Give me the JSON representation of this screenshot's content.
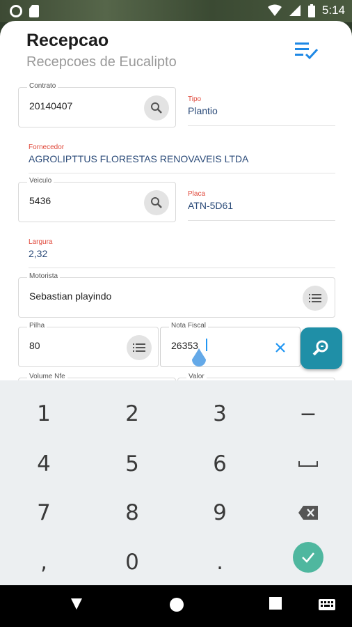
{
  "status_bar": {
    "time": "5:14"
  },
  "header": {
    "title": "Recepcao",
    "subtitle": "Recepcoes de Eucalipto"
  },
  "form": {
    "contrato": {
      "label": "Contrato",
      "value": "20140407"
    },
    "tipo": {
      "label": "Tipo",
      "value": "Plantio"
    },
    "fornecedor": {
      "label": "Fornecedor",
      "value": "AGROLIPTTUS FLORESTAS RENOVAVEIS LTDA"
    },
    "veiculo": {
      "label": "Veiculo",
      "value": "5436"
    },
    "placa": {
      "label": "Placa",
      "value": "ATN-5D61"
    },
    "largura": {
      "label": "Largura",
      "value": "2,32"
    },
    "motorista": {
      "label": "Motorista",
      "value": "Sebastian playindo"
    },
    "pilha": {
      "label": "Pilha",
      "value": "80"
    },
    "nota_fiscal": {
      "label": "Nota Fiscal",
      "value": "26353"
    },
    "volume_nfe": {
      "label": "Volume Nfe",
      "value": ""
    },
    "valor": {
      "label": "Valor",
      "value": ""
    }
  },
  "keypad": {
    "keys": [
      "1",
      "2",
      "3",
      "−",
      "4",
      "5",
      "6",
      "␣",
      "7",
      "8",
      "9",
      "⌫",
      ",",
      "0",
      ".",
      "✓"
    ]
  },
  "colors": {
    "fab": "#1f8fa7",
    "accent_blue": "#2196f3",
    "label_red": "#e04a3c",
    "value_blue": "#2a4a78",
    "ok_green": "#4fb79f"
  }
}
